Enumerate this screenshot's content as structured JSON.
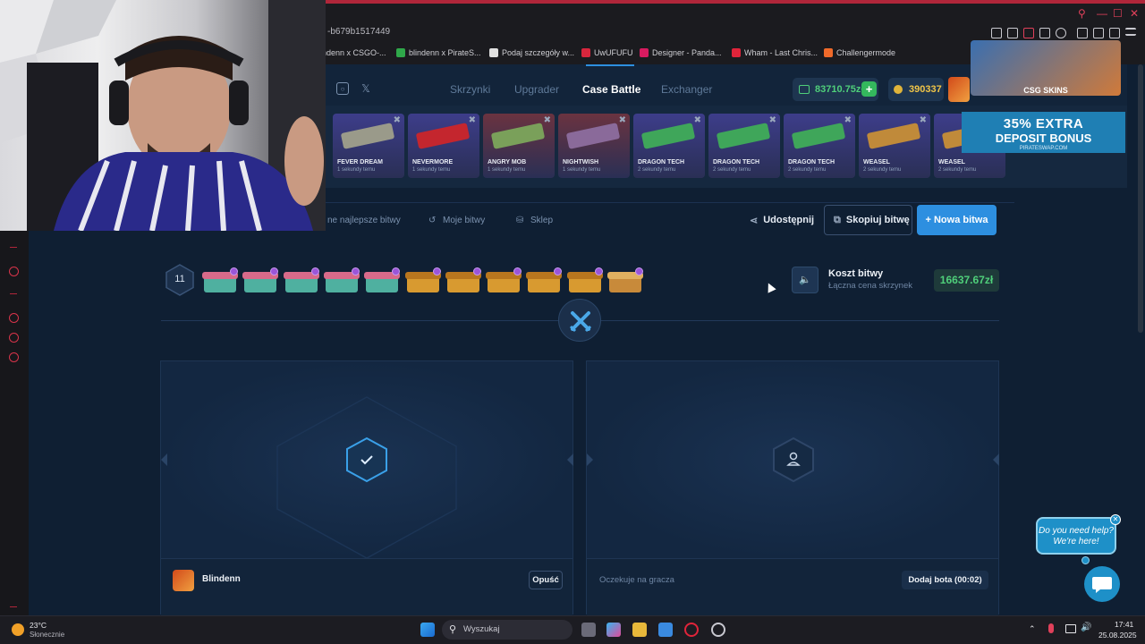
{
  "browser": {
    "url_fragment": "-b679b1517449",
    "bookmarks": [
      {
        "label": "indenn x CSGO-...",
        "color": "#c04a2a"
      },
      {
        "label": "blindenn x PirateS...",
        "color": "#2fa84a"
      },
      {
        "label": "Podaj szczegóły w...",
        "color": "#e0e0e0"
      },
      {
        "label": "UwUFUFU",
        "color": "#d7263d"
      },
      {
        "label": "Designer - Panda...",
        "color": "#d81b60"
      },
      {
        "label": "Wham - Last Chris...",
        "color": "#e0243a"
      },
      {
        "label": "Challengermode",
        "color": "#f06a2a"
      }
    ]
  },
  "site": {
    "nav": {
      "tabs": [
        {
          "label": "Skrzynki"
        },
        {
          "label": "Upgrader"
        },
        {
          "label": "Case Battle"
        },
        {
          "label": "Exchanger"
        }
      ],
      "balance": "83710.75zł",
      "points": "390337"
    },
    "live_drops": [
      {
        "name": "FEVER DREAM",
        "sub": "1 sekundy temu",
        "bg": "#3d3d8a",
        "gun": "#9a9a8a"
      },
      {
        "name": "NEVERMORE",
        "sub": "1 sekundy temu",
        "bg": "#3d3d8a",
        "gun": "#c4262e"
      },
      {
        "name": "ANGRY MOB",
        "sub": "1 sekundy temu",
        "bg": "#6a3340",
        "gun": "#7aa05a"
      },
      {
        "name": "NIGHTWISH",
        "sub": "1 sekundy temu",
        "bg": "#6a3340",
        "gun": "#8a6a9a"
      },
      {
        "name": "DRAGON TECH",
        "sub": "2 sekundy temu",
        "bg": "#3d3d8a",
        "gun": "#3fa65a"
      },
      {
        "name": "DRAGON TECH",
        "sub": "2 sekundy temu",
        "bg": "#3d3d8a",
        "gun": "#3fa65a"
      },
      {
        "name": "DRAGON TECH",
        "sub": "2 sekundy temu",
        "bg": "#3d3d8a",
        "gun": "#3fa65a"
      },
      {
        "name": "WEASEL",
        "sub": "2 sekundy temu",
        "bg": "#3d3d8a",
        "gun": "#c08a3a"
      },
      {
        "name": "WEASEL",
        "sub": "2 sekundy temu",
        "bg": "#3d3d8a",
        "gun": "#c08a3a"
      }
    ],
    "ad": {
      "brand": "CSG SKINS",
      "bonus_line1": "35% EXTRA",
      "bonus_line2": "DEPOSIT BONUS",
      "bonus_line3": "PIRATESWAP.COM"
    },
    "subnav": {
      "links": [
        "ne najlepsze bitwy",
        "Moje bitwy",
        "Sklep"
      ],
      "share": "Udostępnij",
      "copy": "Skopiuj bitwę",
      "new_battle": "+ Nowa bitwa"
    },
    "battle": {
      "rounds": "11",
      "cost_label": "Koszt bitwy",
      "cost_sub": "Łączna cena skrzynek",
      "cost_value": "16637.67zł",
      "cases": [
        {
          "type": "teal"
        },
        {
          "type": "teal"
        },
        {
          "type": "teal"
        },
        {
          "type": "teal"
        },
        {
          "type": "teal"
        },
        {
          "type": "gold"
        },
        {
          "type": "gold"
        },
        {
          "type": "gold"
        },
        {
          "type": "gold"
        },
        {
          "type": "gold"
        },
        {
          "type": "gold2"
        }
      ],
      "player1": {
        "name": "Blindenn",
        "action": "Opuść"
      },
      "player2": {
        "status": "Oczekuje na gracza",
        "action": "Dodaj bota (00:02)"
      }
    },
    "chat": {
      "line1": "Do you need help?",
      "line2": "We're here!"
    }
  },
  "taskbar": {
    "weather_temp": "23°C",
    "weather_desc": "Słonecznie",
    "search": "Wyszukaj",
    "time": "17:41",
    "date": "25.08.2025"
  }
}
